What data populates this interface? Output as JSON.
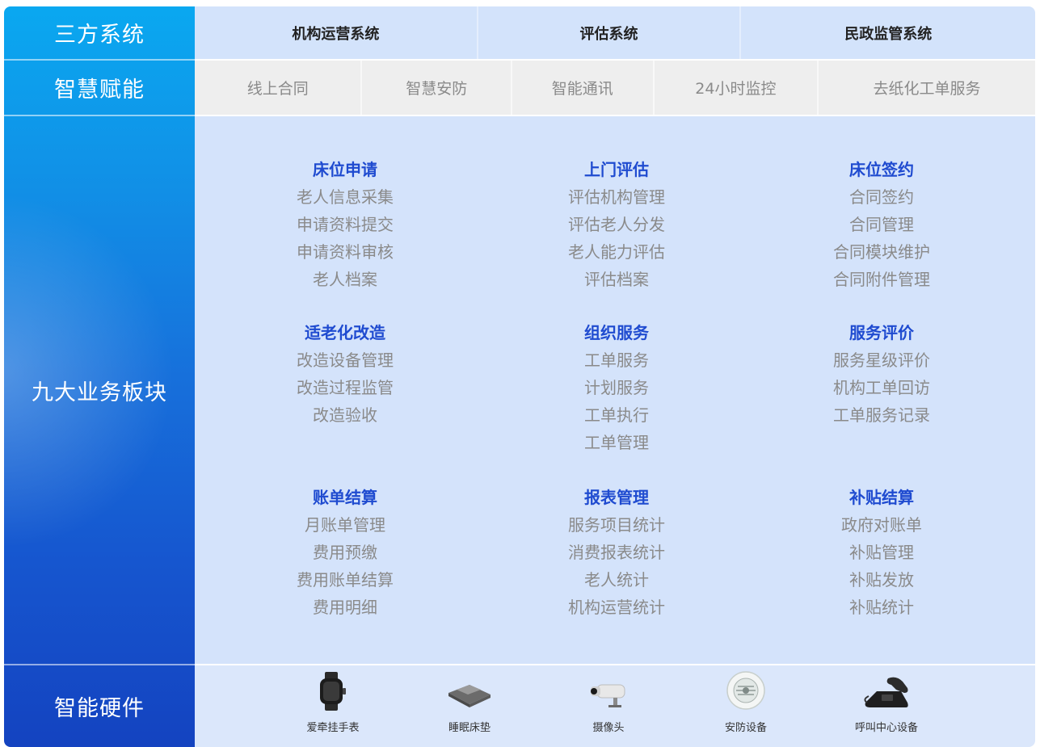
{
  "sidebar": {
    "third_party": "三方系统",
    "smart_empower": "智慧赋能",
    "nine_modules": "九大业务板块",
    "smart_hardware": "智能硬件"
  },
  "systems": [
    "机构运营系统",
    "评估系统",
    "民政监管系统"
  ],
  "features": [
    "线上合同",
    "智慧安防",
    "智能通讯",
    "24小时监控",
    "去纸化工单服务"
  ],
  "modules": [
    {
      "title": "床位申请",
      "items": [
        "老人信息采集",
        "申请资料提交",
        "申请资料审核",
        "老人档案"
      ]
    },
    {
      "title": "上门评估",
      "items": [
        "评估机构管理",
        "评估老人分发",
        "老人能力评估",
        "评估档案"
      ]
    },
    {
      "title": "床位签约",
      "items": [
        "合同签约",
        "合同管理",
        "合同模块维护",
        "合同附件管理"
      ]
    },
    {
      "title": "适老化改造",
      "items": [
        "改造设备管理",
        "改造过程监管",
        "改造验收"
      ]
    },
    {
      "title": "组织服务",
      "items": [
        "工单服务",
        "计划服务",
        "工单执行",
        "工单管理"
      ]
    },
    {
      "title": "服务评价",
      "items": [
        "服务星级评价",
        "机构工单回访",
        "工单服务记录"
      ]
    },
    {
      "title": "账单结算",
      "items": [
        "月账单管理",
        "费用预缴",
        "费用账单结算",
        "费用明细"
      ]
    },
    {
      "title": "报表管理",
      "items": [
        "服务项目统计",
        "消费报表统计",
        "老人统计",
        "机构运营统计"
      ]
    },
    {
      "title": "补贴结算",
      "items": [
        "政府对账单",
        "补贴管理",
        "补贴发放",
        "补贴统计"
      ]
    }
  ],
  "hardware": [
    {
      "label": "爱牵挂手表",
      "icon": "smartwatch-icon"
    },
    {
      "label": "睡眠床垫",
      "icon": "sleep-mattress-icon"
    },
    {
      "label": "摄像头",
      "icon": "camera-icon"
    },
    {
      "label": "安防设备",
      "icon": "security-device-icon"
    },
    {
      "label": "呼叫中心设备",
      "icon": "call-center-phone-icon"
    }
  ]
}
